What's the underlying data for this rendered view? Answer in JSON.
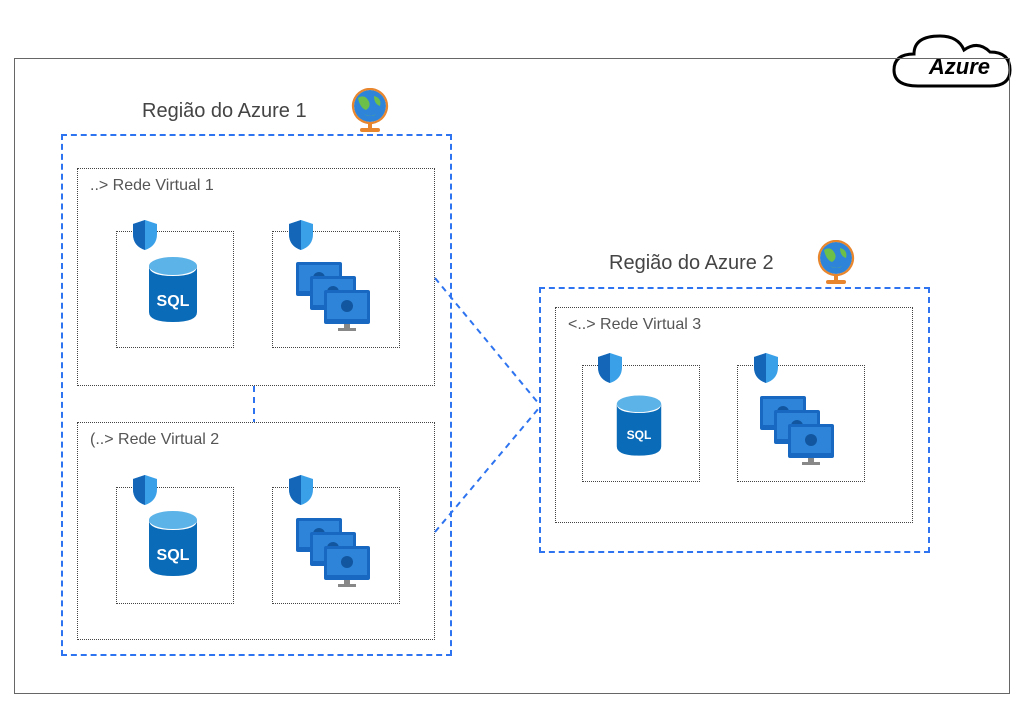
{
  "cloud_label": "Azure",
  "region1": {
    "title": "Região do Azure 1",
    "vnet1": {
      "label": "..> Rede Virtual 1"
    },
    "vnet2": {
      "label": "(..> Rede Virtual 2"
    }
  },
  "region2": {
    "title": "Região do Azure 2",
    "vnet3": {
      "label": "<..> Rede Virtual 3"
    }
  },
  "sql_label": "SQL"
}
